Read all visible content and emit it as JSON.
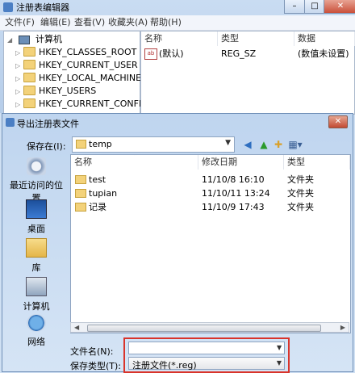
{
  "registry_editor": {
    "title": "注册表编辑器",
    "menu": [
      "文件(F)",
      "编辑(E)",
      "查看(V)",
      "收藏夹(A)",
      "帮助(H)"
    ],
    "tree": {
      "root": "计算机",
      "keys": [
        "HKEY_CLASSES_ROOT",
        "HKEY_CURRENT_USER",
        "HKEY_LOCAL_MACHINE",
        "HKEY_USERS",
        "HKEY_CURRENT_CONFIG"
      ]
    },
    "list": {
      "columns": [
        "名称",
        "类型",
        "数据"
      ],
      "rows": [
        {
          "name": "(默认)",
          "type": "REG_SZ",
          "data": "(数值未设置)",
          "icon": "string-value-icon"
        }
      ]
    }
  },
  "dialog": {
    "title": "导出注册表文件",
    "save_in_label": "保存在(I):",
    "save_in_value": "temp",
    "places": [
      "最近访问的位置",
      "桌面",
      "库",
      "计算机",
      "网络"
    ],
    "columns": [
      "名称",
      "修改日期",
      "类型"
    ],
    "files": [
      {
        "name": "test",
        "date": "11/10/8 16:10",
        "type": "文件夹"
      },
      {
        "name": "tupian",
        "date": "11/10/11 13:24",
        "type": "文件夹"
      },
      {
        "name": "记录",
        "date": "11/10/9 17:43",
        "type": "文件夹"
      }
    ],
    "filename_label": "文件名(N):",
    "filename_value": "",
    "filetype_label": "保存类型(T):",
    "filetype_value": "注册文件(*.reg)"
  },
  "colors": {
    "highlight_box": "#d9342b",
    "title_gradient": "#bfd5ef"
  }
}
